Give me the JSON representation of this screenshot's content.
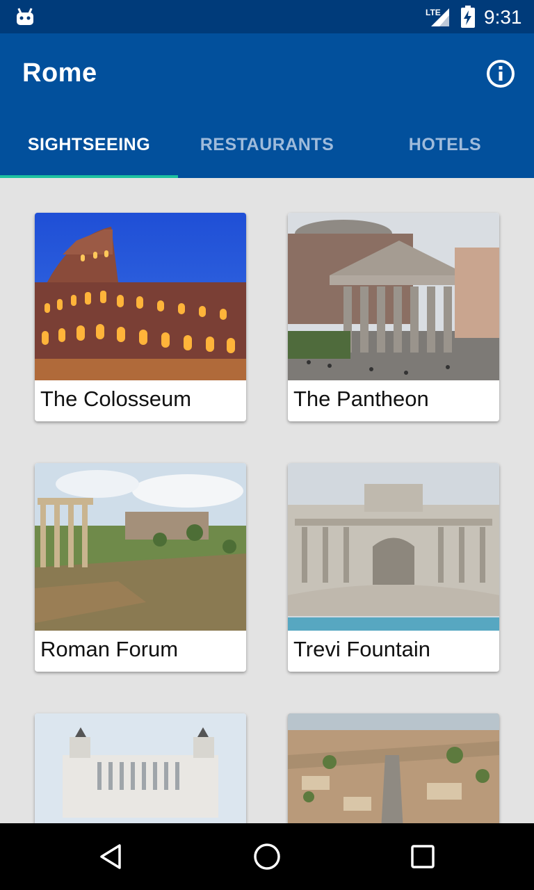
{
  "status_bar": {
    "time": "9:31",
    "network_label": "LTE",
    "icons": [
      "android-robot-icon",
      "lte-signal-icon",
      "battery-charging-icon"
    ]
  },
  "app_bar": {
    "title": "Rome",
    "info_icon": "info-icon",
    "color": "#02509c"
  },
  "tabs": [
    {
      "label": "SIGHTSEEING",
      "selected": true
    },
    {
      "label": "RESTAURANTS",
      "selected": false
    },
    {
      "label": "HOTELS",
      "selected": false
    }
  ],
  "accent_color": "#1ec2a0",
  "places": [
    {
      "name": "The Colosseum"
    },
    {
      "name": "The Pantheon"
    },
    {
      "name": "Roman Forum"
    },
    {
      "name": "Trevi Fountain"
    },
    {
      "name": ""
    },
    {
      "name": ""
    }
  ],
  "nav_bar": {
    "buttons": [
      "back-icon",
      "home-icon",
      "recents-icon"
    ]
  }
}
